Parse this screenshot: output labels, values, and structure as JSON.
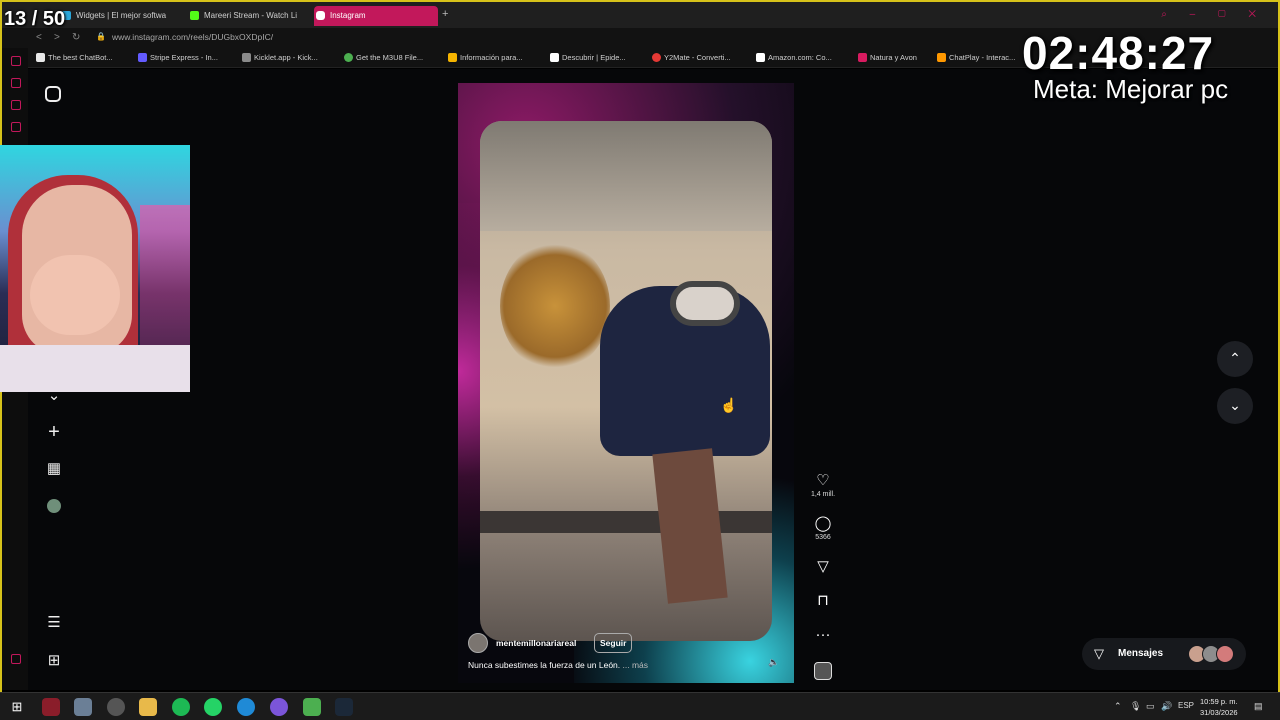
{
  "browser": {
    "tabs": [
      {
        "label": "Widgets | El mejor softwa",
        "icon": "widgets-tab-icon",
        "color": "#2aa6d9"
      },
      {
        "label": "Mareeri Stream - Watch Li",
        "icon": "kick-tab-icon",
        "color": "#53fc18"
      },
      {
        "label": "Instagram",
        "icon": "instagram-tab-icon",
        "color": "#e1306c",
        "active": true
      }
    ],
    "new_tab": "+",
    "url": "www.instagram.com/reels/DUGbxOXDpIC/",
    "bookmarks": [
      {
        "label": "The best ChatBot...",
        "icon": "chatbot-icon",
        "color": "#e8e8e8"
      },
      {
        "label": "Stripe Express - In...",
        "icon": "stripe-icon",
        "color": "#635bff"
      },
      {
        "label": "Kicklet.app - Kick...",
        "icon": "kicklet-icon",
        "color": "#8a8a8a"
      },
      {
        "label": "Get the M3U8 File...",
        "icon": "m3u8-icon",
        "color": "#4caf50"
      },
      {
        "label": "Información para...",
        "icon": "info-icon",
        "color": "#f5b400"
      },
      {
        "label": "Descubrir | Epide...",
        "icon": "google-icon",
        "color": "#ffffff"
      },
      {
        "label": "Y2Mate - Converti...",
        "icon": "y2mate-icon",
        "color": "#e53935"
      },
      {
        "label": "Amazon.com: Co...",
        "icon": "amazon-icon",
        "color": "#ffffff"
      },
      {
        "label": "Natura y Avon",
        "icon": "natura-icon",
        "color": "#d81b60"
      },
      {
        "label": "ChatPlay - Interac...",
        "icon": "chatplay-icon",
        "color": "#ff9800"
      }
    ]
  },
  "reel": {
    "username": "mentemillonariareal",
    "follow_label": "Seguir",
    "caption": "Nunca subestimes la fuerza de un León.",
    "more_label": "... más",
    "likes": "1,4 mill.",
    "comments": "5366"
  },
  "messages": {
    "label": "Mensajes"
  },
  "overlay": {
    "counter": "13 / 50",
    "timer": "02:48:27",
    "goal": "Meta: Mejorar pc"
  },
  "taskbar": {
    "language": "ESP",
    "time": "10:59 p. m.",
    "date": "31/03/2026"
  },
  "colors": {
    "accent": "#c2185b",
    "frame": "#d6c21a"
  }
}
